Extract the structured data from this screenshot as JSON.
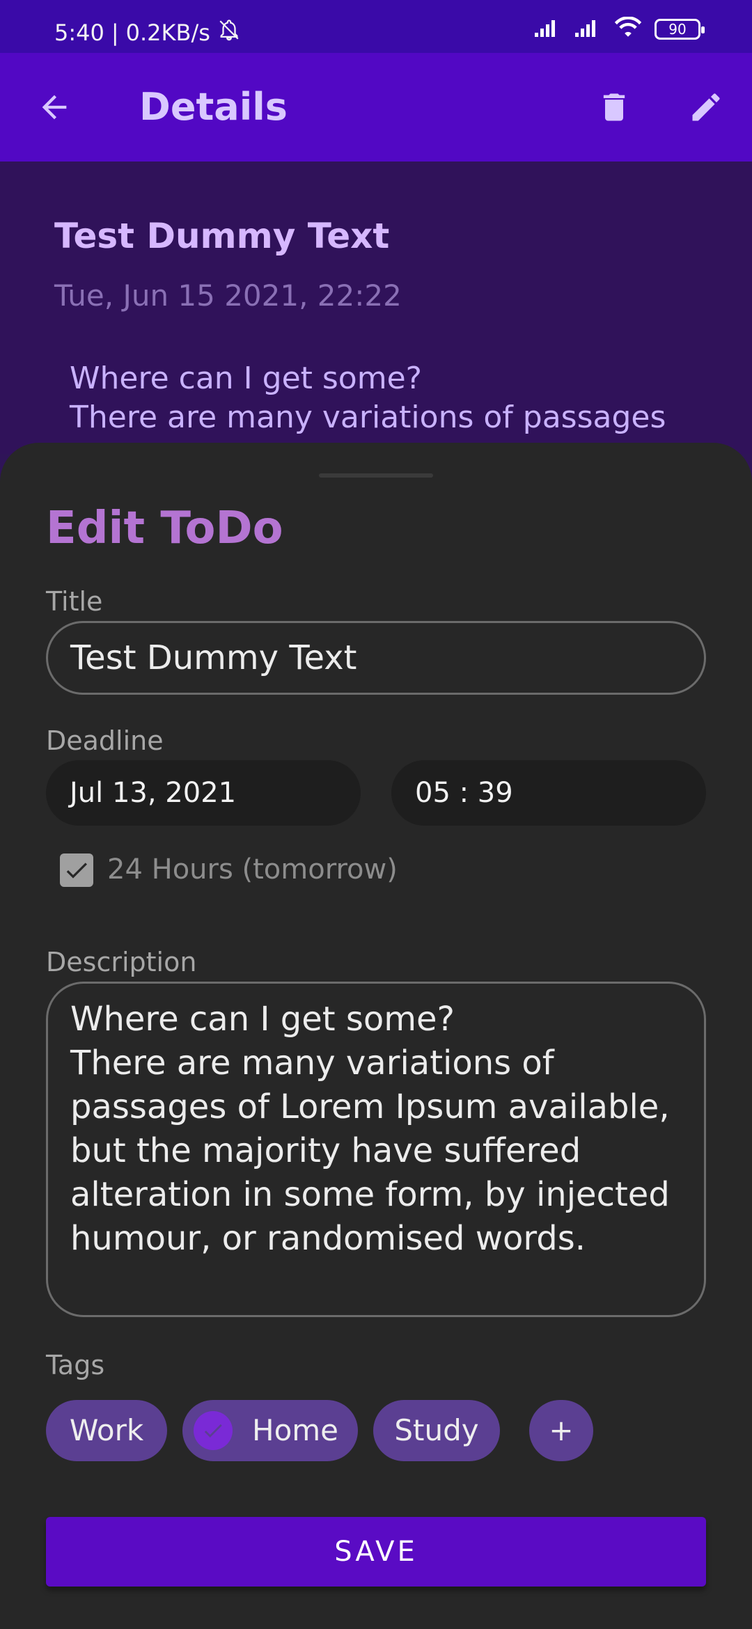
{
  "status_bar": {
    "time": "5:40",
    "net_speed": "0.2KB/s",
    "battery": "90"
  },
  "app_bar": {
    "title": "Details"
  },
  "details": {
    "title": "Test Dummy Text",
    "date": "Tue, Jun 15 2021, 22:22",
    "body_line1": "Where can I get some?",
    "body_line2": "There are many variations of passages"
  },
  "sheet": {
    "heading": "Edit ToDo",
    "title_label": "Title",
    "title_value": "Test Dummy Text",
    "deadline_label": "Deadline",
    "date_value": "Jul 13, 2021",
    "time_value": "05 : 39",
    "checkbox_label": "24 Hours (tomorrow)",
    "checkbox_checked": true,
    "description_label": "Description",
    "description_value": "Where can I get some?\nThere are many variations of passages of Lorem Ipsum available, but the majority have suffered alteration in some form, by injected humour, or randomised words.",
    "tags_label": "Tags",
    "tags": [
      {
        "label": "Work",
        "selected": false
      },
      {
        "label": "Home",
        "selected": true
      },
      {
        "label": "Study",
        "selected": false
      }
    ],
    "add_tag": "+",
    "save_label": "SAVE"
  },
  "colors": {
    "status_bar": "#3a0aa8",
    "app_bar": "#5208c4",
    "sheet_bg": "#272727",
    "heading": "#b474d2",
    "chip": "#5b3f92",
    "save_button": "#5a0bc4"
  }
}
